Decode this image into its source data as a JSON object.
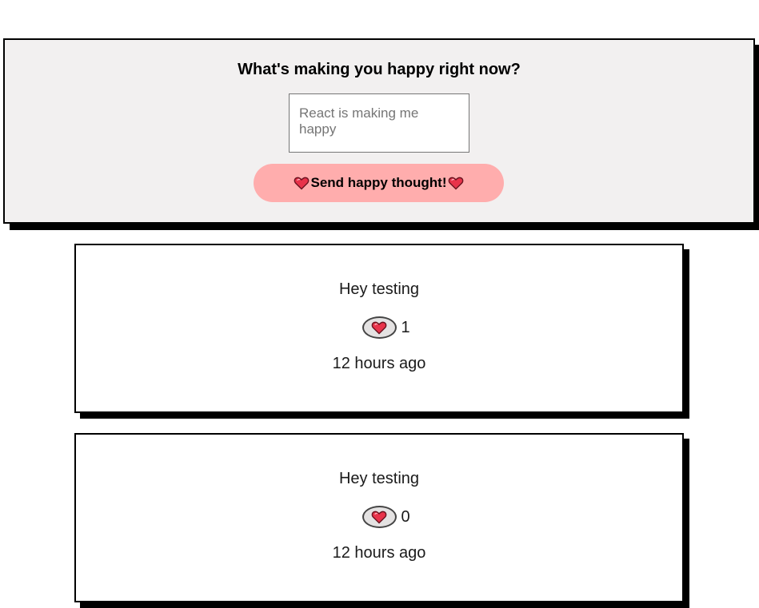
{
  "form": {
    "title": "What's making you happy right now?",
    "input_placeholder": "React is making me happy",
    "input_value": "",
    "send_label": "Send happy thought!"
  },
  "thoughts": [
    {
      "message": "Hey testing",
      "likes": "1",
      "time": "12 hours ago"
    },
    {
      "message": "Hey testing",
      "likes": "0",
      "time": "12 hours ago"
    }
  ],
  "icons": {
    "heart": "heart-icon"
  },
  "colors": {
    "form_background": "#f2f0f0",
    "send_button": "#ffadad",
    "heart": "#e8334a",
    "like_button_bg": "#e4e2e2",
    "shadow": "#000000"
  }
}
